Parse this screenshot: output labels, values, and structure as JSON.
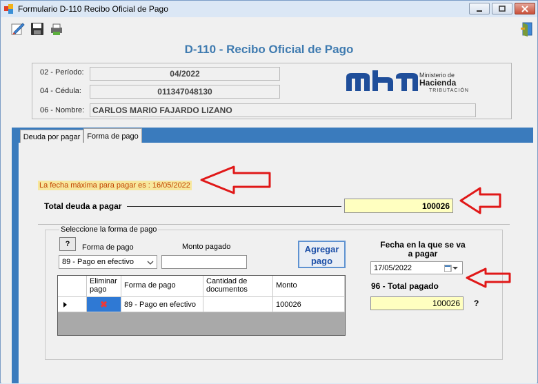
{
  "window": {
    "title": "Formulario  D-110 Recibo Oficial de Pago"
  },
  "form": {
    "heading": "D-110 -  Recibo Oficial de Pago",
    "periodo_label": "02 - Período:",
    "periodo_value": "04/2022",
    "cedula_label": "04 - Cédula:",
    "cedula_value": "011347048130",
    "nombre_label": "06 - Nombre:",
    "nombre_value": "CARLOS MARIO FAJARDO LIZANO"
  },
  "logo": {
    "mark": "mh",
    "line1": "Ministerio de",
    "line2": "Hacienda",
    "line3": "TRIBUTACIÓN"
  },
  "tabs": [
    {
      "label": "Deuda por pagar",
      "active": false
    },
    {
      "label": "Forma de pago",
      "active": true
    }
  ],
  "payment": {
    "due_notice": "La fecha máxima para pagar es : 16/05/2022",
    "total_debt_label": "Total deuda a pagar",
    "total_debt_value": "100026",
    "group_title": "Seleccione la forma de pago",
    "help_button": "?",
    "method_label": "Forma de pago",
    "amount_label": "Monto pagado",
    "method_selected": "89 - Pago en efectivo",
    "amount_value": "",
    "add_button_line1": "Agregar",
    "add_button_line2": "pago",
    "date_label_line1": "Fecha en la que se va",
    "date_label_line2": "a pagar",
    "date_value": "17/05/2022",
    "total_paid_label": "96 - Total pagado",
    "total_paid_value": "100026",
    "total_paid_help": "?"
  },
  "grid": {
    "columns": [
      "Eliminar pago",
      "Forma de pago",
      "Cantidad de documentos",
      "Monto"
    ],
    "rows": [
      {
        "delete": "✖",
        "method": "89 - Pago en efectivo",
        "docs": "",
        "amount": "100026"
      }
    ]
  },
  "colors": {
    "accent_blue": "#3a7bbd",
    "heading_blue": "#3f7bb0",
    "highlight_yellow": "#ffffc0",
    "annotation_red": "#e01818"
  }
}
